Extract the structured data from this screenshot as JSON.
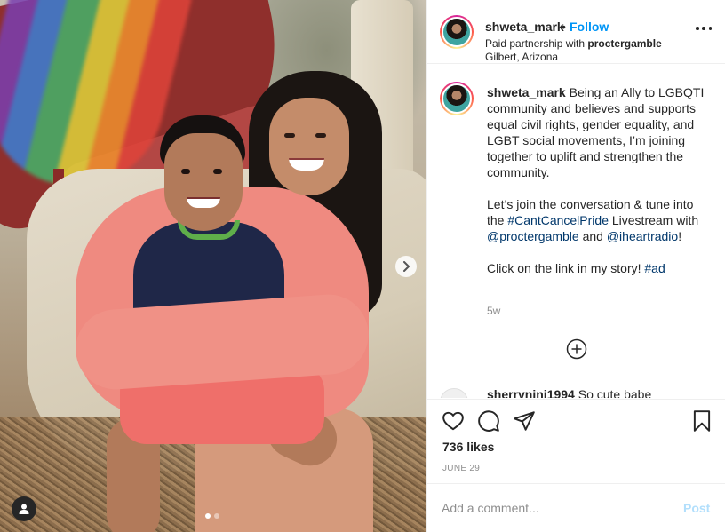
{
  "post": {
    "username": "shweta_mark",
    "dot": "•",
    "follow_label": "Follow",
    "paid_prefix": "Paid partnership with",
    "partner": "proctergamble",
    "location": "Gilbert, Arizona"
  },
  "caption": {
    "username": "shweta_mark",
    "para1": "Being an Ally to LGBQTI community and believes and supports equal civil rights, gender equality, and LGBT social movements, I’m joining together to uplift and strengthen the community.",
    "para2_a": "Let’s join the conversation & tune into the",
    "para2_tag": "#CantCancelPride",
    "para2_b": "Livestream with",
    "para2_mention1": "@proctergamble",
    "para2_c": "and",
    "para2_mention2": "@iheartradio",
    "para2_d": "!",
    "para3": "Click on the link in my story!",
    "para3_tag": "#ad",
    "time": "5w"
  },
  "next_comment": {
    "username": "sherryninj1994",
    "text": "So cute babe"
  },
  "actions": {
    "likes": "736 likes",
    "date": "JUNE 29"
  },
  "comment_box": {
    "placeholder": "Add a comment...",
    "post_label": "Post"
  },
  "icons": {
    "like": "heart-icon",
    "comment": "comment-icon",
    "share": "paper-plane-icon",
    "save": "bookmark-icon",
    "more": "more-options-icon",
    "load_more": "plus-circle-icon",
    "next": "chevron-right-icon",
    "tags": "user-tag-icon"
  },
  "colors": {
    "accent": "#0095f6",
    "post_disabled": "#b2dffc",
    "hashtag": "#00376b",
    "muted": "#8e8e8e"
  },
  "carousel": {
    "total": 2,
    "active_index": 0
  }
}
